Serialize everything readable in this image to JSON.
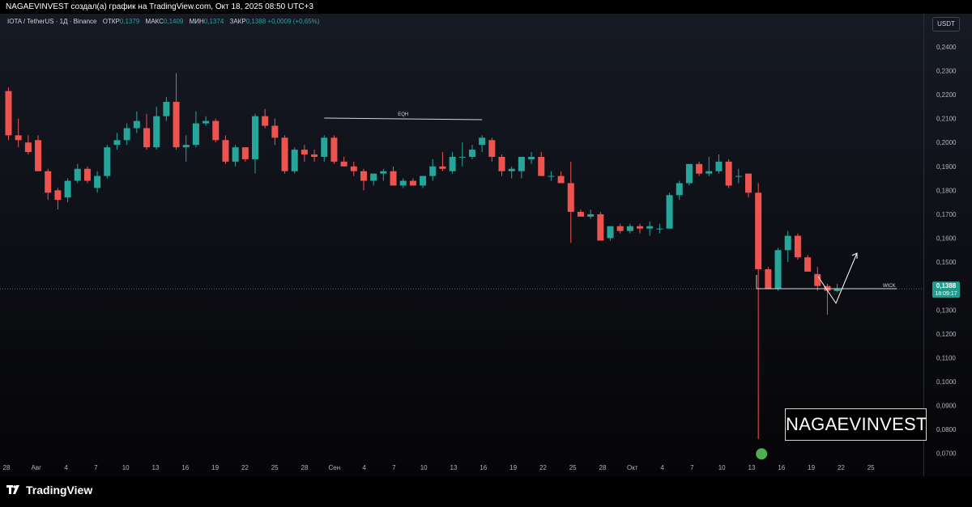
{
  "header": {
    "caption": "NAGAEVINVEST создал(а) график на TradingView.com, Окт 18, 2025 08:50 UTC+3"
  },
  "legend": {
    "symbol": "IOTA / TetherUS · 1Д · Binance",
    "open_label": "ОТКР",
    "open_value": "0,1379",
    "high_label": "МАКС",
    "high_value": "0,1409",
    "low_label": "МИН",
    "low_value": "0,1374",
    "close_label": "ЗАКР",
    "close_value": "0,1388",
    "change": "+0,0009 (+0,65%)"
  },
  "currency_button": "USDT",
  "watermark": "NAGAEVINVEST",
  "branding": {
    "logo_text": "TradingView",
    "logo_icon": "tradingview-logo-icon"
  },
  "colors": {
    "up": "#26a69a",
    "down": "#ef5350",
    "background": "#131722",
    "price_label_bg": "#1e9e8e",
    "marker": "#4caf50"
  },
  "chart_data": {
    "type": "candlestick",
    "timeframe": "1Д",
    "y_axis": {
      "ticks": [
        "0,0700",
        "0,0800",
        "0,0900",
        "0,1000",
        "0,1100",
        "0,1200",
        "0,1300",
        "0,1400",
        "0,1500",
        "0,1600",
        "0,1700",
        "0,1800",
        "0,1900",
        "0,2000",
        "0,2100",
        "0,2200",
        "0,2300",
        "0,2400"
      ],
      "range": [
        0.0645,
        0.242
      ]
    },
    "x_axis": {
      "ticks": [
        "28",
        "Авг",
        "4",
        "7",
        "10",
        "13",
        "16",
        "19",
        "22",
        "25",
        "28",
        "Сен",
        "4",
        "7",
        "10",
        "13",
        "16",
        "19",
        "22",
        "25",
        "28",
        "Окт",
        "4",
        "7",
        "10",
        "13",
        "16",
        "19",
        "22",
        "25"
      ]
    },
    "current_price": {
      "value": 0.1388,
      "label": "0,1388",
      "countdown": "18:09:17"
    },
    "annotations": [
      {
        "type": "label",
        "text": "EQH",
        "from_candle": 32,
        "to_candle": 48
      },
      {
        "type": "label",
        "text": "WICK"
      },
      {
        "type": "marker",
        "shape": "circle",
        "candle": 76,
        "price": 0.0698
      }
    ],
    "candles": [
      {
        "o": 0.2215,
        "h": 0.223,
        "l": 0.201,
        "c": 0.203
      },
      {
        "o": 0.203,
        "h": 0.21,
        "l": 0.198,
        "c": 0.201
      },
      {
        "o": 0.2,
        "h": 0.203,
        "l": 0.195,
        "c": 0.196
      },
      {
        "o": 0.201,
        "h": 0.203,
        "l": 0.188,
        "c": 0.188
      },
      {
        "o": 0.188,
        "h": 0.189,
        "l": 0.176,
        "c": 0.179
      },
      {
        "o": 0.18,
        "h": 0.181,
        "l": 0.172,
        "c": 0.176
      },
      {
        "o": 0.177,
        "h": 0.185,
        "l": 0.175,
        "c": 0.184
      },
      {
        "o": 0.184,
        "h": 0.191,
        "l": 0.183,
        "c": 0.189
      },
      {
        "o": 0.189,
        "h": 0.19,
        "l": 0.183,
        "c": 0.184
      },
      {
        "o": 0.181,
        "h": 0.188,
        "l": 0.179,
        "c": 0.186
      },
      {
        "o": 0.186,
        "h": 0.199,
        "l": 0.185,
        "c": 0.198
      },
      {
        "o": 0.199,
        "h": 0.204,
        "l": 0.197,
        "c": 0.201
      },
      {
        "o": 0.201,
        "h": 0.208,
        "l": 0.199,
        "c": 0.206
      },
      {
        "o": 0.206,
        "h": 0.213,
        "l": 0.204,
        "c": 0.209
      },
      {
        "o": 0.206,
        "h": 0.212,
        "l": 0.197,
        "c": 0.198
      },
      {
        "o": 0.198,
        "h": 0.215,
        "l": 0.197,
        "c": 0.211
      },
      {
        "o": 0.211,
        "h": 0.219,
        "l": 0.209,
        "c": 0.217
      },
      {
        "o": 0.217,
        "h": 0.229,
        "l": 0.197,
        "c": 0.198
      },
      {
        "o": 0.198,
        "h": 0.203,
        "l": 0.192,
        "c": 0.199
      },
      {
        "o": 0.199,
        "h": 0.213,
        "l": 0.198,
        "c": 0.208
      },
      {
        "o": 0.208,
        "h": 0.211,
        "l": 0.207,
        "c": 0.209
      },
      {
        "o": 0.209,
        "h": 0.21,
        "l": 0.2,
        "c": 0.201
      },
      {
        "o": 0.201,
        "h": 0.203,
        "l": 0.191,
        "c": 0.192
      },
      {
        "o": 0.192,
        "h": 0.199,
        "l": 0.19,
        "c": 0.198
      },
      {
        "o": 0.198,
        "h": 0.198,
        "l": 0.192,
        "c": 0.193
      },
      {
        "o": 0.193,
        "h": 0.212,
        "l": 0.187,
        "c": 0.211
      },
      {
        "o": 0.211,
        "h": 0.214,
        "l": 0.206,
        "c": 0.207
      },
      {
        "o": 0.207,
        "h": 0.21,
        "l": 0.199,
        "c": 0.202
      },
      {
        "o": 0.202,
        "h": 0.203,
        "l": 0.187,
        "c": 0.188
      },
      {
        "o": 0.188,
        "h": 0.198,
        "l": 0.187,
        "c": 0.197
      },
      {
        "o": 0.197,
        "h": 0.199,
        "l": 0.192,
        "c": 0.195
      },
      {
        "o": 0.195,
        "h": 0.197,
        "l": 0.192,
        "c": 0.194
      },
      {
        "o": 0.194,
        "h": 0.203,
        "l": 0.192,
        "c": 0.202
      },
      {
        "o": 0.202,
        "h": 0.203,
        "l": 0.191,
        "c": 0.192
      },
      {
        "o": 0.192,
        "h": 0.194,
        "l": 0.19,
        "c": 0.19
      },
      {
        "o": 0.19,
        "h": 0.192,
        "l": 0.186,
        "c": 0.188
      },
      {
        "o": 0.188,
        "h": 0.189,
        "l": 0.18,
        "c": 0.184
      },
      {
        "o": 0.184,
        "h": 0.187,
        "l": 0.182,
        "c": 0.187
      },
      {
        "o": 0.187,
        "h": 0.189,
        "l": 0.184,
        "c": 0.188
      },
      {
        "o": 0.188,
        "h": 0.19,
        "l": 0.182,
        "c": 0.182
      },
      {
        "o": 0.182,
        "h": 0.185,
        "l": 0.181,
        "c": 0.184
      },
      {
        "o": 0.184,
        "h": 0.185,
        "l": 0.182,
        "c": 0.182
      },
      {
        "o": 0.182,
        "h": 0.186,
        "l": 0.181,
        "c": 0.186
      },
      {
        "o": 0.186,
        "h": 0.193,
        "l": 0.184,
        "c": 0.19
      },
      {
        "o": 0.19,
        "h": 0.196,
        "l": 0.188,
        "c": 0.189
      },
      {
        "o": 0.188,
        "h": 0.196,
        "l": 0.187,
        "c": 0.194
      },
      {
        "o": 0.194,
        "h": 0.2,
        "l": 0.19,
        "c": 0.194
      },
      {
        "o": 0.194,
        "h": 0.199,
        "l": 0.193,
        "c": 0.197
      },
      {
        "o": 0.199,
        "h": 0.203,
        "l": 0.196,
        "c": 0.202
      },
      {
        "o": 0.201,
        "h": 0.202,
        "l": 0.192,
        "c": 0.194
      },
      {
        "o": 0.194,
        "h": 0.195,
        "l": 0.186,
        "c": 0.188
      },
      {
        "o": 0.188,
        "h": 0.19,
        "l": 0.185,
        "c": 0.189
      },
      {
        "o": 0.188,
        "h": 0.194,
        "l": 0.185,
        "c": 0.194
      },
      {
        "o": 0.193,
        "h": 0.196,
        "l": 0.191,
        "c": 0.194
      },
      {
        "o": 0.194,
        "h": 0.196,
        "l": 0.186,
        "c": 0.186
      },
      {
        "o": 0.186,
        "h": 0.188,
        "l": 0.184,
        "c": 0.186
      },
      {
        "o": 0.186,
        "h": 0.188,
        "l": 0.184,
        "c": 0.183
      },
      {
        "o": 0.183,
        "h": 0.192,
        "l": 0.158,
        "c": 0.171
      },
      {
        "o": 0.171,
        "h": 0.172,
        "l": 0.169,
        "c": 0.169
      },
      {
        "o": 0.169,
        "h": 0.172,
        "l": 0.168,
        "c": 0.17
      },
      {
        "o": 0.17,
        "h": 0.171,
        "l": 0.159,
        "c": 0.159
      },
      {
        "o": 0.16,
        "h": 0.165,
        "l": 0.159,
        "c": 0.165
      },
      {
        "o": 0.165,
        "h": 0.166,
        "l": 0.162,
        "c": 0.163
      },
      {
        "o": 0.163,
        "h": 0.166,
        "l": 0.162,
        "c": 0.165
      },
      {
        "o": 0.165,
        "h": 0.166,
        "l": 0.162,
        "c": 0.164
      },
      {
        "o": 0.164,
        "h": 0.167,
        "l": 0.161,
        "c": 0.165
      },
      {
        "o": 0.164,
        "h": 0.166,
        "l": 0.162,
        "c": 0.164
      },
      {
        "o": 0.164,
        "h": 0.179,
        "l": 0.164,
        "c": 0.178
      },
      {
        "o": 0.178,
        "h": 0.184,
        "l": 0.176,
        "c": 0.183
      },
      {
        "o": 0.183,
        "h": 0.191,
        "l": 0.182,
        "c": 0.191
      },
      {
        "o": 0.191,
        "h": 0.192,
        "l": 0.186,
        "c": 0.187
      },
      {
        "o": 0.187,
        "h": 0.194,
        "l": 0.186,
        "c": 0.188
      },
      {
        "o": 0.188,
        "h": 0.195,
        "l": 0.187,
        "c": 0.192
      },
      {
        "o": 0.192,
        "h": 0.193,
        "l": 0.181,
        "c": 0.182
      },
      {
        "o": 0.186,
        "h": 0.189,
        "l": 0.183,
        "c": 0.186
      },
      {
        "o": 0.187,
        "h": 0.187,
        "l": 0.177,
        "c": 0.179
      },
      {
        "o": 0.179,
        "h": 0.183,
        "l": 0.076,
        "c": 0.147
      },
      {
        "o": 0.147,
        "h": 0.148,
        "l": 0.139,
        "c": 0.139
      },
      {
        "o": 0.139,
        "h": 0.156,
        "l": 0.138,
        "c": 0.155
      },
      {
        "o": 0.155,
        "h": 0.163,
        "l": 0.15,
        "c": 0.161
      },
      {
        "o": 0.161,
        "h": 0.162,
        "l": 0.151,
        "c": 0.152
      },
      {
        "o": 0.152,
        "h": 0.153,
        "l": 0.146,
        "c": 0.146
      },
      {
        "o": 0.145,
        "h": 0.148,
        "l": 0.138,
        "c": 0.14
      },
      {
        "o": 0.14,
        "h": 0.141,
        "l": 0.128,
        "c": 0.138
      },
      {
        "o": 0.1379,
        "h": 0.1409,
        "l": 0.1374,
        "c": 0.1388
      }
    ]
  }
}
